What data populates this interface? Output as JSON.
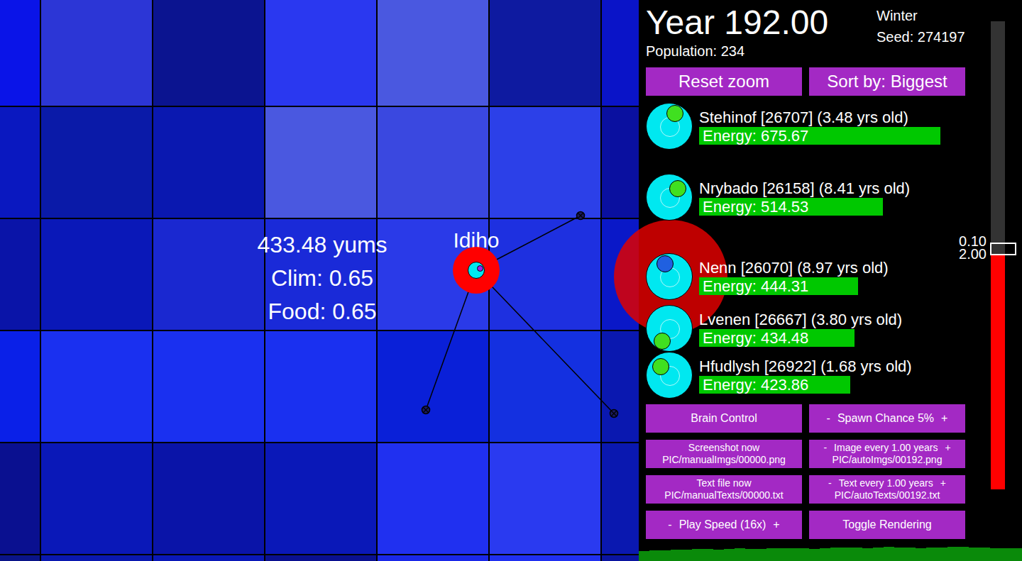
{
  "world": {
    "info": {
      "food": "433.48 yums",
      "climate": "Clim: 0.65",
      "food_level": "Food: 0.65"
    },
    "tiles": [
      [
        {
          "color": "#0a14e8"
        },
        {
          "color": "#2c36d6"
        },
        {
          "color": "#0b1490"
        },
        {
          "color": "#2a38f0"
        },
        {
          "color": "#4a58e0"
        },
        {
          "color": "#0e1aa0"
        },
        {
          "color": "#0a14c8"
        }
      ],
      [
        {
          "color": "#0a18c0"
        },
        {
          "color": "#0a1aa8"
        },
        {
          "color": "#0a18b0"
        },
        {
          "color": "#4a58e0"
        },
        {
          "color": "#3a48e0"
        },
        {
          "color": "#2c40e8"
        },
        {
          "color": "#0a10a0"
        }
      ],
      [
        {
          "color": "#0a14a8"
        },
        {
          "color": "#0a18b8"
        },
        {
          "color": "#1a28d0"
        },
        {
          "color": "#1a2ad8"
        },
        {
          "color": "#2a3ae8"
        },
        {
          "color": "#1e30e0"
        },
        {
          "color": "#0a18c8"
        }
      ],
      [
        {
          "color": "#0a20e8"
        },
        {
          "color": "#1a30f0"
        },
        {
          "color": "#1a30f0"
        },
        {
          "color": "#1a30f0"
        },
        {
          "color": "#0a20d8"
        },
        {
          "color": "#1430e0"
        },
        {
          "color": "#0a18b0"
        }
      ],
      [
        {
          "color": "#0a1090"
        },
        {
          "color": "#0a18b8"
        },
        {
          "color": "#0a14a8"
        },
        {
          "color": "#0a18b8"
        },
        {
          "color": "#2030f0"
        },
        {
          "color": "#2a3af0"
        },
        {
          "color": "#0a18b0"
        }
      ],
      [
        {
          "color": "#0a1488"
        },
        {
          "color": "#0a18b0"
        },
        {
          "color": "#0a18b8"
        },
        {
          "color": "#0a1090"
        },
        {
          "color": "#1a28e8"
        },
        {
          "color": "#2030f0"
        },
        {
          "color": "#0a14a0"
        }
      ]
    ]
  },
  "creature": {
    "name": "Idiho"
  },
  "header": {
    "year": "Year 192.00",
    "season": "Winter",
    "seed": "Seed: 274197",
    "population": "Population: 234"
  },
  "top_buttons": [
    "Reset zoom",
    "Sort by: Biggest"
  ],
  "leaderboard": [
    {
      "name": "Stehinof [26707] (3.48 yrs old)",
      "energy": "Energy: 675.67",
      "level": 1.0,
      "color": "#40e020"
    },
    {
      "name": "Nrybado [26158] (8.41 yrs old)",
      "energy": "Energy: 514.53",
      "level": 0.761,
      "color": "#40e020"
    },
    {
      "name": "Nenn [26070] (8.97 yrs old)",
      "energy": "Energy: 444.31",
      "level": 0.658,
      "color": "#2060e0"
    },
    {
      "name": "Lvenen [26667] (3.80 yrs old)",
      "energy": "Energy: 434.48",
      "level": 0.643,
      "color": "#40e020"
    },
    {
      "name": "Hfudlysh [26922] (1.68 yrs old)",
      "energy": "Energy: 423.86",
      "level": 0.627,
      "color": "#40e020"
    }
  ],
  "slider": {
    "labels": [
      "0.10",
      "2.00"
    ],
    "level": 0.5
  },
  "controls": [
    {
      "label": "Brain Control"
    },
    {
      "minus": "-",
      "label": "Spawn Chance 5%",
      "plus": "+"
    },
    {
      "label": "Screenshot now",
      "sub": "PIC/manualImgs/00000.png"
    },
    {
      "minus": "-",
      "label": "Image every 1.00 years",
      "plus": "+",
      "sub": "PIC/autoImgs/00192.png"
    },
    {
      "label": "Text file now",
      "sub": "PIC/manualTexts/00000.txt"
    },
    {
      "minus": "-",
      "label": "Text every 1.00 years",
      "plus": "+",
      "sub": "PIC/autoTexts/00192.txt"
    },
    {
      "minus": "-",
      "label": "Play Speed (16x)",
      "plus": "+"
    },
    {
      "label": "Toggle Rendering"
    }
  ],
  "population_chart": {
    "values": [
      180,
      195,
      200,
      210,
      205,
      215,
      220,
      212,
      225,
      230,
      222,
      218,
      228,
      235,
      240,
      232,
      226,
      238,
      245,
      250,
      242,
      236,
      248,
      255,
      252,
      246,
      240,
      244,
      250,
      258,
      254,
      248,
      242,
      238,
      236,
      234
    ]
  }
}
